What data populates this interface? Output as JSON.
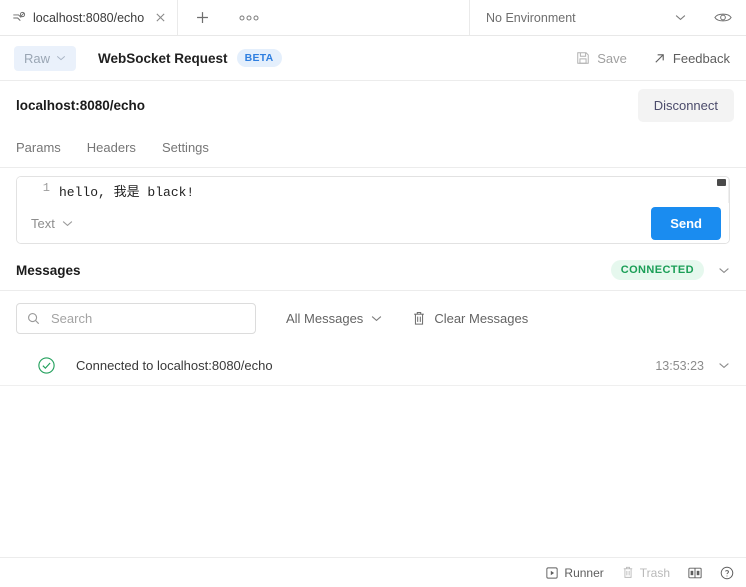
{
  "tabbar": {
    "tab": {
      "icon": "websocket-icon",
      "title": "localhost:8080/echo",
      "close_icon": "close-icon"
    },
    "new_tab_icon": "plus-icon",
    "more_icon": "ellipsis-icon",
    "environment": {
      "selected": "No Environment",
      "chevron_icon": "chevron-down-icon"
    },
    "eye_icon": "eye-icon"
  },
  "request_header": {
    "raw_label": "Raw",
    "raw_chevron_icon": "chevron-down-icon",
    "title": "WebSocket Request",
    "beta_badge": "BETA",
    "save_label": "Save",
    "save_icon": "save-floppy-icon",
    "feedback_label": "Feedback",
    "feedback_icon": "external-link-icon"
  },
  "url_row": {
    "url": "localhost:8080/echo",
    "disconnect_label": "Disconnect"
  },
  "subtabs": [
    {
      "label": "Params",
      "name": "tab-params"
    },
    {
      "label": "Headers",
      "name": "tab-headers"
    },
    {
      "label": "Settings",
      "name": "tab-settings"
    }
  ],
  "editor": {
    "line_number": "1",
    "content": "hello, 我是 black!",
    "format_label": "Text",
    "format_chevron_icon": "chevron-down-icon",
    "send_label": "Send",
    "send_color": "#1a8cf0"
  },
  "messages": {
    "title": "Messages",
    "status_badge": "CONNECTED",
    "status_color": "#1a9e56",
    "collapse_icon": "chevron-down-icon",
    "search": {
      "placeholder": "Search",
      "value": "",
      "icon": "search-icon"
    },
    "filter": {
      "label": "All Messages",
      "chevron_icon": "chevron-down-icon"
    },
    "clear": {
      "label": "Clear Messages",
      "icon": "trash-icon"
    },
    "rows": [
      {
        "icon": "check-circle-icon",
        "text": "Connected to localhost:8080/echo",
        "time": "13:53:23",
        "chevron_icon": "chevron-down-icon"
      }
    ]
  },
  "footer": {
    "runner_label": "Runner",
    "runner_icon": "runner-icon",
    "trash_label": "Trash",
    "trash_icon": "trash-icon",
    "layout_icon": "two-pane-layout-icon",
    "help_icon": "help-circle-icon"
  }
}
